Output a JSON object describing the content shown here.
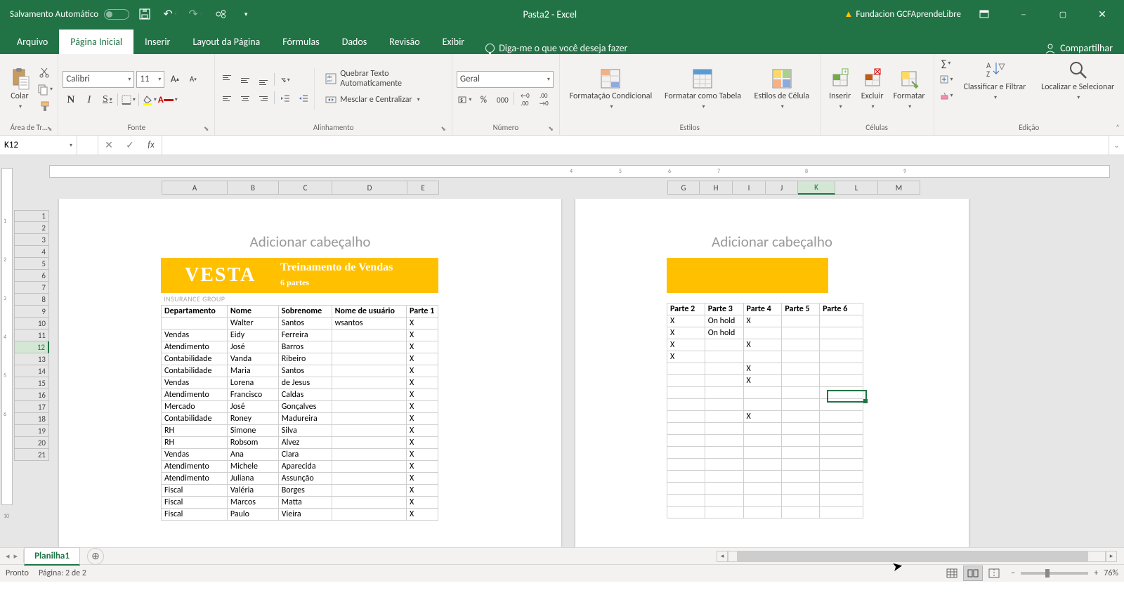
{
  "title_bar": {
    "auto_save": "Salvamento Automático",
    "doc_title": "Pasta2  -  Excel",
    "account": "Fundacion GCFAprendeLibre"
  },
  "tabs": {
    "file": "Arquivo",
    "home": "Página Inicial",
    "insert": "Inserir",
    "layout": "Layout da Página",
    "formulas": "Fórmulas",
    "data": "Dados",
    "review": "Revisão",
    "view": "Exibir",
    "tell_me": "Diga-me o que você deseja fazer",
    "share": "Compartilhar"
  },
  "ribbon": {
    "clipboard": {
      "paste": "Colar",
      "label": "Área de Tr…"
    },
    "font": {
      "name": "Calibri",
      "size": "11",
      "label": "Fonte"
    },
    "alignment": {
      "wrap": "Quebrar Texto Automaticamente",
      "merge": "Mesclar e Centralizar",
      "label": "Alinhamento"
    },
    "number": {
      "format": "Geral",
      "label": "Número"
    },
    "styles": {
      "cond": "Formatação Condicional",
      "table": "Formatar como Tabela",
      "cell": "Estilos de Célula",
      "label": "Estilos"
    },
    "cells": {
      "insert": "Inserir",
      "delete": "Excluir",
      "format": "Formatar",
      "label": "Células"
    },
    "editing": {
      "sort": "Classificar e Filtrar",
      "find": "Localizar e Selecionar",
      "label": "Edição"
    }
  },
  "namebox": "K12",
  "page_header": "Adicionar cabeçalho",
  "banner": {
    "vesta": "VESTA",
    "training": "Treinamento de Vendas",
    "parts": "6 partes",
    "ins_group": "INSURANCE GROUP"
  },
  "columns_p1": [
    "A",
    "B",
    "C",
    "D",
    "E"
  ],
  "columns_p2": [
    "G",
    "H",
    "I",
    "J",
    "K",
    "L",
    "M"
  ],
  "headers_p1": [
    "Departamento",
    "Nome",
    "Sobrenome",
    "Nome de usuário",
    "Parte 1"
  ],
  "headers_p2": [
    "Parte 2",
    "Parte 3",
    "Parte 4",
    "Parte 5",
    "Parte 6"
  ],
  "rows": [
    {
      "dep": "",
      "nome": "Walter",
      "sob": "Santos",
      "user": "wsantos",
      "p1": "X",
      "p2": "X",
      "p3": "On hold",
      "p4": "X",
      "p5": "",
      "p6": ""
    },
    {
      "dep": "Vendas",
      "nome": "Eidy",
      "sob": "Ferreira",
      "user": "",
      "p1": "X",
      "p2": "X",
      "p3": "On hold",
      "p4": "",
      "p5": "",
      "p6": ""
    },
    {
      "dep": "Atendimento",
      "nome": "José",
      "sob": "Barros",
      "user": "",
      "p1": "X",
      "p2": "X",
      "p3": "",
      "p4": "X",
      "p5": "",
      "p6": ""
    },
    {
      "dep": "Contabilidade",
      "nome": "Vanda",
      "sob": "Ribeiro",
      "user": "",
      "p1": "X",
      "p2": "X",
      "p3": "",
      "p4": "",
      "p5": "",
      "p6": ""
    },
    {
      "dep": "Contabilidade",
      "nome": "Maria",
      "sob": "Santos",
      "user": "",
      "p1": "X",
      "p2": "",
      "p3": "",
      "p4": "X",
      "p5": "",
      "p6": ""
    },
    {
      "dep": "Vendas",
      "nome": "Lorena",
      "sob": "de Jesus",
      "user": "",
      "p1": "X",
      "p2": "",
      "p3": "",
      "p4": "X",
      "p5": "",
      "p6": ""
    },
    {
      "dep": "Atendimento",
      "nome": "Francisco",
      "sob": "Caldas",
      "user": "",
      "p1": "X",
      "p2": "",
      "p3": "",
      "p4": "",
      "p5": "",
      "p6": ""
    },
    {
      "dep": "Mercado",
      "nome": "José",
      "sob": "Gonçalves",
      "user": "",
      "p1": "X",
      "p2": "",
      "p3": "",
      "p4": "",
      "p5": "",
      "p6": ""
    },
    {
      "dep": "Contabilidade",
      "nome": "Roney",
      "sob": "Madureira",
      "user": "",
      "p1": "X",
      "p2": "",
      "p3": "",
      "p4": "X",
      "p5": "",
      "p6": ""
    },
    {
      "dep": "RH",
      "nome": "Simone",
      "sob": "Silva",
      "user": "",
      "p1": "X",
      "p2": "",
      "p3": "",
      "p4": "",
      "p5": "",
      "p6": ""
    },
    {
      "dep": "RH",
      "nome": "Robsom",
      "sob": "Alvez",
      "user": "",
      "p1": "X",
      "p2": "",
      "p3": "",
      "p4": "",
      "p5": "",
      "p6": ""
    },
    {
      "dep": "Vendas",
      "nome": "Ana",
      "sob": "Clara",
      "user": "",
      "p1": "X",
      "p2": "",
      "p3": "",
      "p4": "",
      "p5": "",
      "p6": ""
    },
    {
      "dep": "Atendimento",
      "nome": "Michele",
      "sob": "Aparecida",
      "user": "",
      "p1": "X",
      "p2": "",
      "p3": "",
      "p4": "",
      "p5": "",
      "p6": ""
    },
    {
      "dep": "Atendimento",
      "nome": "Juliana",
      "sob": "Assunção",
      "user": "",
      "p1": "X",
      "p2": "",
      "p3": "",
      "p4": "",
      "p5": "",
      "p6": ""
    },
    {
      "dep": "Fiscal",
      "nome": "Valéria",
      "sob": "Borges",
      "user": "",
      "p1": "X",
      "p2": "",
      "p3": "",
      "p4": "",
      "p5": "",
      "p6": ""
    },
    {
      "dep": "Fiscal",
      "nome": "Marcos",
      "sob": "Matta",
      "user": "",
      "p1": "X",
      "p2": "",
      "p3": "",
      "p4": "",
      "p5": "",
      "p6": ""
    },
    {
      "dep": "Fiscal",
      "nome": "Paulo",
      "sob": "Vieira",
      "user": "",
      "p1": "X",
      "p2": "",
      "p3": "",
      "p4": "",
      "p5": "",
      "p6": ""
    }
  ],
  "row_numbers": [
    "1",
    "2",
    "3",
    "4",
    "5",
    "6",
    "7",
    "8",
    "9",
    "10",
    "11",
    "12",
    "13",
    "14",
    "15",
    "16",
    "17",
    "18",
    "19",
    "20",
    "21"
  ],
  "selected_row": "12",
  "sheet_tab": "Planilha1",
  "status": {
    "ready": "Pronto",
    "page": "Página: 2 de 2",
    "zoom": "76%"
  },
  "hruler_ticks": [
    "4",
    "5",
    "6",
    "7",
    "",
    "8",
    "",
    "",
    "9"
  ],
  "vruler_ticks": [
    "1",
    "2",
    "3",
    "4",
    "5",
    "6",
    "",
    "",
    "",
    "10"
  ]
}
